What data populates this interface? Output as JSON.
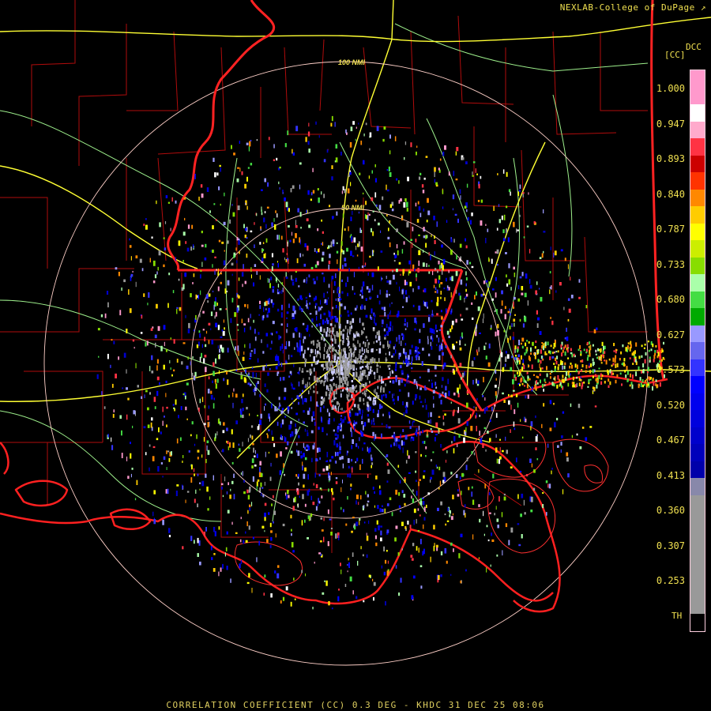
{
  "header": {
    "credit": "NEXLAB-College of DuPage"
  },
  "map": {
    "range_rings": [
      "100 NMI",
      "50 NMI"
    ],
    "colors": {
      "state_border": "#ff2222",
      "parish_border": "#cc1010",
      "coastline": "#ff2020",
      "highway": "#ffff30",
      "road": "#a0ff90",
      "ring": "#ffd0c8"
    }
  },
  "legend": {
    "product": "DCC",
    "units": "[CC]",
    "ticks": [
      "1.000",
      "0.947",
      "0.893",
      "0.840",
      "0.787",
      "0.733",
      "0.680",
      "0.627",
      "0.573",
      "0.520",
      "0.467",
      "0.413",
      "0.360",
      "0.307",
      "0.253"
    ],
    "threshold_label": "TH",
    "colors": [
      "#ff99cc",
      "#ff99cc",
      "#ffffff",
      "#ffaacc",
      "#ff3344",
      "#cc0000",
      "#ff3300",
      "#ff8800",
      "#ffcc00",
      "#ffff00",
      "#ccee00",
      "#88dd00",
      "#aaffaa",
      "#44dd44",
      "#00aa00",
      "#9999ff",
      "#6666ee",
      "#3333ff",
      "#0000ff",
      "#0000ee",
      "#0000dd",
      "#0000cc",
      "#0000bb",
      "#0000aa",
      "#8888aa",
      "#999999",
      "#999999",
      "#999999",
      "#999999",
      "#999999",
      "#999999",
      "#999999",
      "#000000"
    ]
  },
  "footer": {
    "caption": "CORRELATION COEFFICIENT (CC) 0.3 DEG - KHDC 31 DEC 25 08:06"
  }
}
